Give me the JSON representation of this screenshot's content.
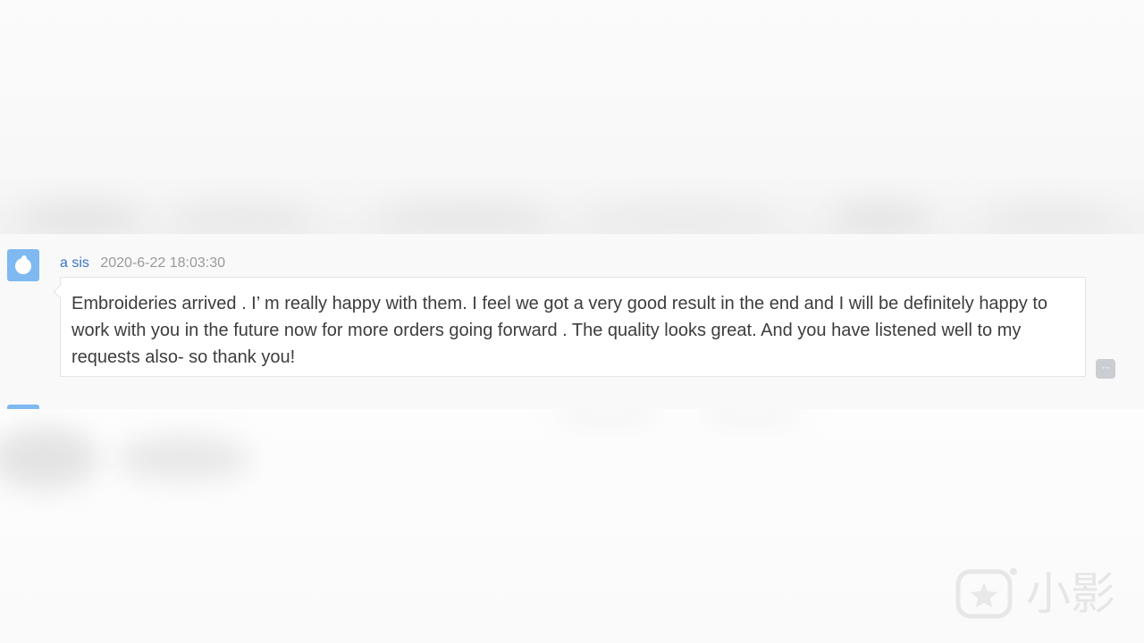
{
  "message": {
    "sender": "a sis",
    "timestamp": "2020-6-22 18:03:30",
    "text": "Embroideries arrived . I’  m really happy with them. I feel we got a very good result in the end and I will be definitely happy to work with you in the future now for more orders going forward . The quality looks great. And you have listened well to my requests also- so thank you!"
  },
  "more_button_label": "···",
  "watermark": {
    "text": "小影",
    "icon": "video-star-icon"
  },
  "colors": {
    "sender": "#3a73c6",
    "timestamp": "#9a9a9a",
    "avatar": "#7fb9f1",
    "message_text": "#3d3d3d"
  }
}
